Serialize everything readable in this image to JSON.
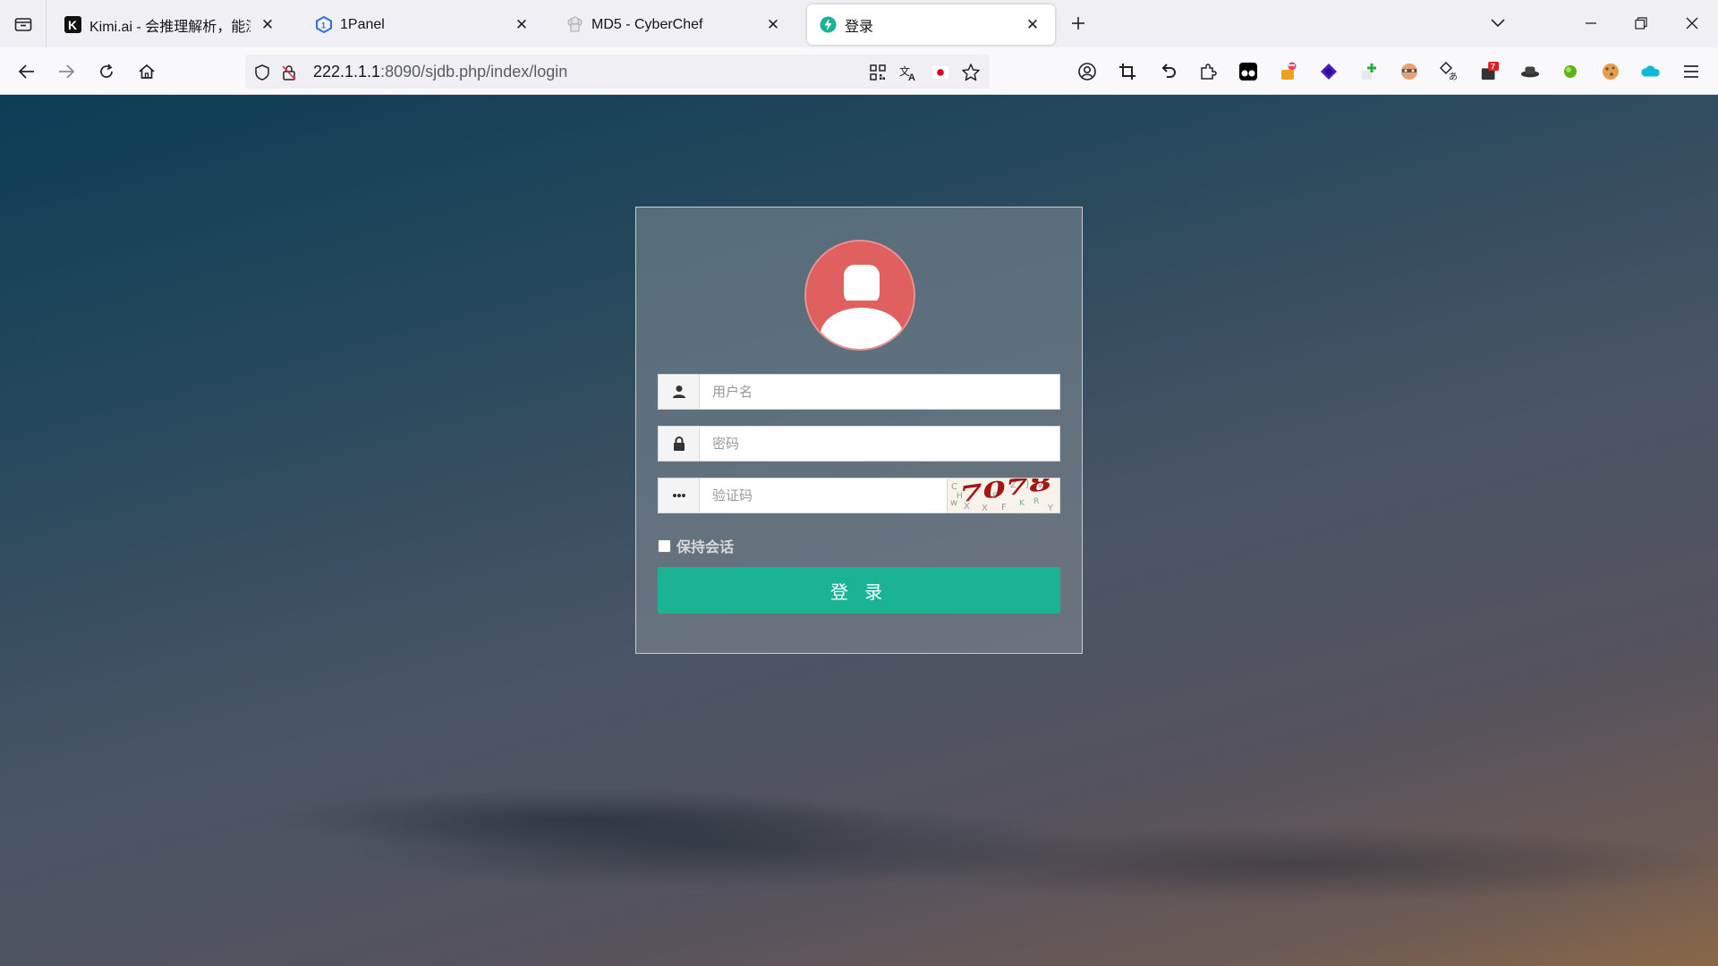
{
  "browser": {
    "tabs": [
      {
        "title": "Kimi.ai - 会推理解析，能深度思",
        "icon": "kimi-favicon"
      },
      {
        "title": "1Panel",
        "icon": "1panel-favicon"
      },
      {
        "title": "MD5 - CyberChef",
        "icon": "cyberchef-favicon"
      },
      {
        "title": "登录",
        "icon": "login-favicon"
      }
    ],
    "url_host": "222.1.1.1",
    "url_rest": ":8090/sjdb.php/index/login",
    "extension_badge": "7"
  },
  "login": {
    "username_placeholder": "用户名",
    "password_placeholder": "密码",
    "captcha_placeholder": "验证码",
    "captcha_text": "7078",
    "remember_label": "保持会话",
    "submit_label": "登 录"
  },
  "colors": {
    "accent": "#1ab394",
    "avatar_bg": "#e06060"
  }
}
